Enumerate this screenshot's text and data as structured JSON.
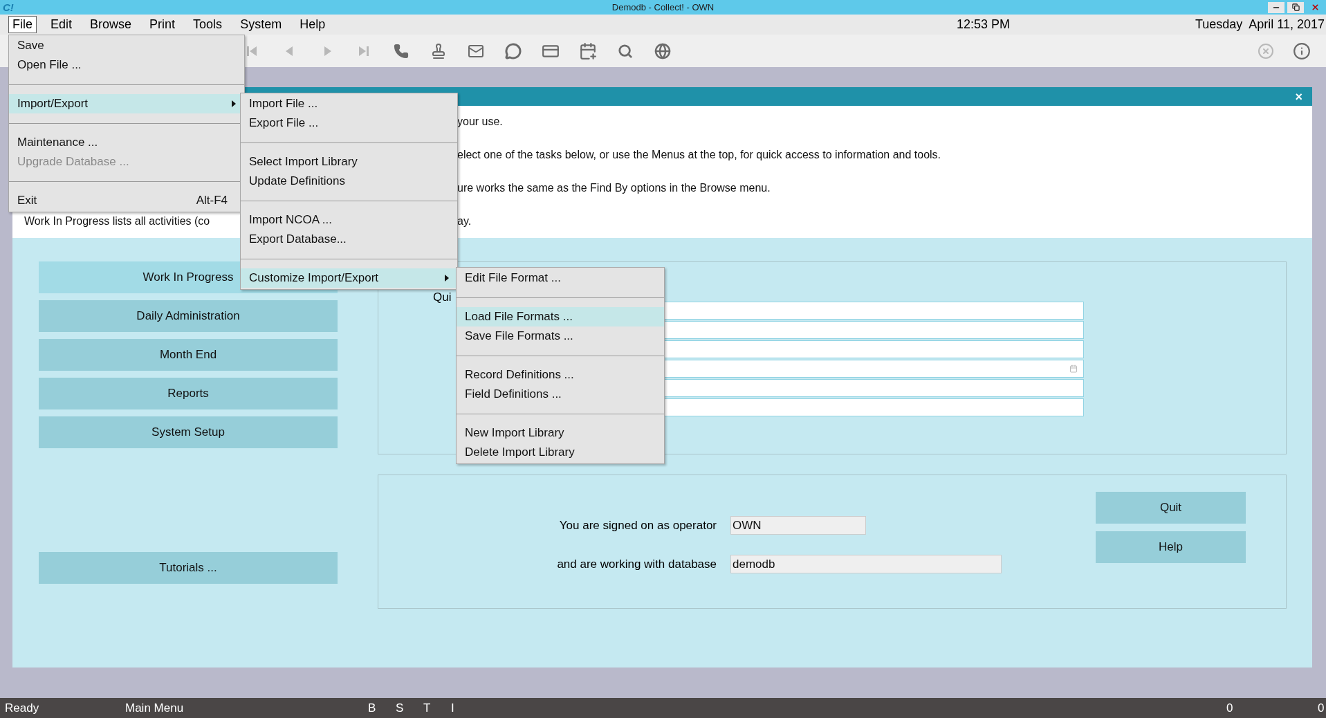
{
  "window": {
    "logo": "C!",
    "title": "Demodb - Collect! - OWN"
  },
  "menu_bar": {
    "items": [
      {
        "label": "File",
        "selected": true
      },
      {
        "label": "Edit",
        "selected": false
      },
      {
        "label": "Browse",
        "selected": false
      },
      {
        "label": "Print",
        "selected": false
      },
      {
        "label": "Tools",
        "selected": false
      },
      {
        "label": "System",
        "selected": false
      },
      {
        "label": "Help",
        "selected": false
      }
    ],
    "time": "12:53 PM",
    "date": "Tuesday  April 11, 2017"
  },
  "toolbar": {
    "tools": [
      {
        "disabled": true
      },
      {
        "disabled": true
      },
      {
        "disabled": true
      },
      {
        "disabled": true
      },
      {
        "disabled": false
      },
      {
        "disabled": false
      },
      {
        "disabled": false
      },
      {
        "disabled": false
      },
      {
        "disabled": false
      },
      {
        "disabled": false
      },
      {
        "disabled": false
      },
      {
        "disabled": false
      }
    ],
    "right_tools": [
      {
        "disabled": true
      },
      {
        "disabled": false
      }
    ]
  },
  "panel": {
    "close": "×",
    "intro_lines": [
      {
        "right": "your use."
      },
      {
        "right": "elect one of the tasks below, or use the Menus at the top, for quick access to information and tools."
      },
      {
        "right": "ure works the same as the Find By options in the Browse menu."
      },
      {
        "left": "Work In Progress lists all activities (co",
        "right": "ay."
      }
    ]
  },
  "tasks": [
    {
      "label": "Work In Progress",
      "focused": true
    },
    {
      "label": "Daily Administration",
      "focused": false
    },
    {
      "label": "Month End",
      "focused": false
    },
    {
      "label": "Reports",
      "focused": false
    },
    {
      "label": "System Setup",
      "focused": false
    }
  ],
  "tutorials": "Tutorials ...",
  "quick_find": {
    "label": "Qui",
    "fields": [
      {
        "kind": "text"
      },
      {
        "kind": "text"
      },
      {
        "kind": "text"
      },
      {
        "kind": "date"
      },
      {
        "kind": "text"
      },
      {
        "kind": "text"
      }
    ]
  },
  "session": {
    "operator_label": "You are signed on as operator",
    "operator": "OWN",
    "database_label": "and are working with database",
    "database": "demodb"
  },
  "buttons": [
    "Quit",
    "Help"
  ],
  "file_menu": [
    {
      "kind": "item",
      "label": "Save",
      "disabled": false,
      "selected": false
    },
    {
      "kind": "item",
      "label": "Open File ...",
      "disabled": false,
      "selected": false
    },
    {
      "kind": "separator"
    },
    {
      "kind": "submenu",
      "label": "Import/Export",
      "disabled": false,
      "selected": true
    },
    {
      "kind": "separator"
    },
    {
      "kind": "item",
      "label": "Maintenance ...",
      "disabled": false,
      "selected": false
    },
    {
      "kind": "item",
      "label": "Upgrade Database ...",
      "disabled": true,
      "selected": false
    },
    {
      "kind": "separator"
    },
    {
      "kind": "item",
      "label": "Exit",
      "shortcut": "Alt-F4",
      "disabled": false,
      "selected": false
    }
  ],
  "import_export_menu": [
    {
      "kind": "item",
      "label": "Import File ...",
      "disabled": false,
      "selected": false
    },
    {
      "kind": "item",
      "label": "Export File ...",
      "disabled": false,
      "selected": false
    },
    {
      "kind": "separator"
    },
    {
      "kind": "item",
      "label": "Select Import Library",
      "disabled": false,
      "selected": false
    },
    {
      "kind": "item",
      "label": "Update Definitions",
      "disabled": false,
      "selected": false
    },
    {
      "kind": "separator"
    },
    {
      "kind": "item",
      "label": "Import NCOA ...",
      "disabled": false,
      "selected": false
    },
    {
      "kind": "item",
      "label": "Export Database...",
      "disabled": false,
      "selected": false
    },
    {
      "kind": "separator"
    },
    {
      "kind": "submenu",
      "label": "Customize Import/Export",
      "disabled": false,
      "selected": true
    }
  ],
  "customize_menu": [
    {
      "kind": "item",
      "label": "Edit File Format ...",
      "disabled": false,
      "selected": false
    },
    {
      "kind": "separator"
    },
    {
      "kind": "item",
      "label": "Load File Formats ...",
      "disabled": false,
      "selected": true
    },
    {
      "kind": "item",
      "label": "Save File Formats ...",
      "disabled": false,
      "selected": false
    },
    {
      "kind": "separator"
    },
    {
      "kind": "item",
      "label": "Record Definitions ...",
      "disabled": false,
      "selected": false
    },
    {
      "kind": "item",
      "label": "Field Definitions ...",
      "disabled": false,
      "selected": false
    },
    {
      "kind": "separator"
    },
    {
      "kind": "item",
      "label": "New Import Library",
      "disabled": false,
      "selected": false
    },
    {
      "kind": "item",
      "label": "Delete Import Library",
      "disabled": false,
      "selected": false
    }
  ],
  "status_bar": {
    "status": "Ready",
    "screen": "Main Menu",
    "flags": [
      "B",
      "S",
      "T",
      "I"
    ],
    "counts": [
      "0",
      "0"
    ]
  }
}
